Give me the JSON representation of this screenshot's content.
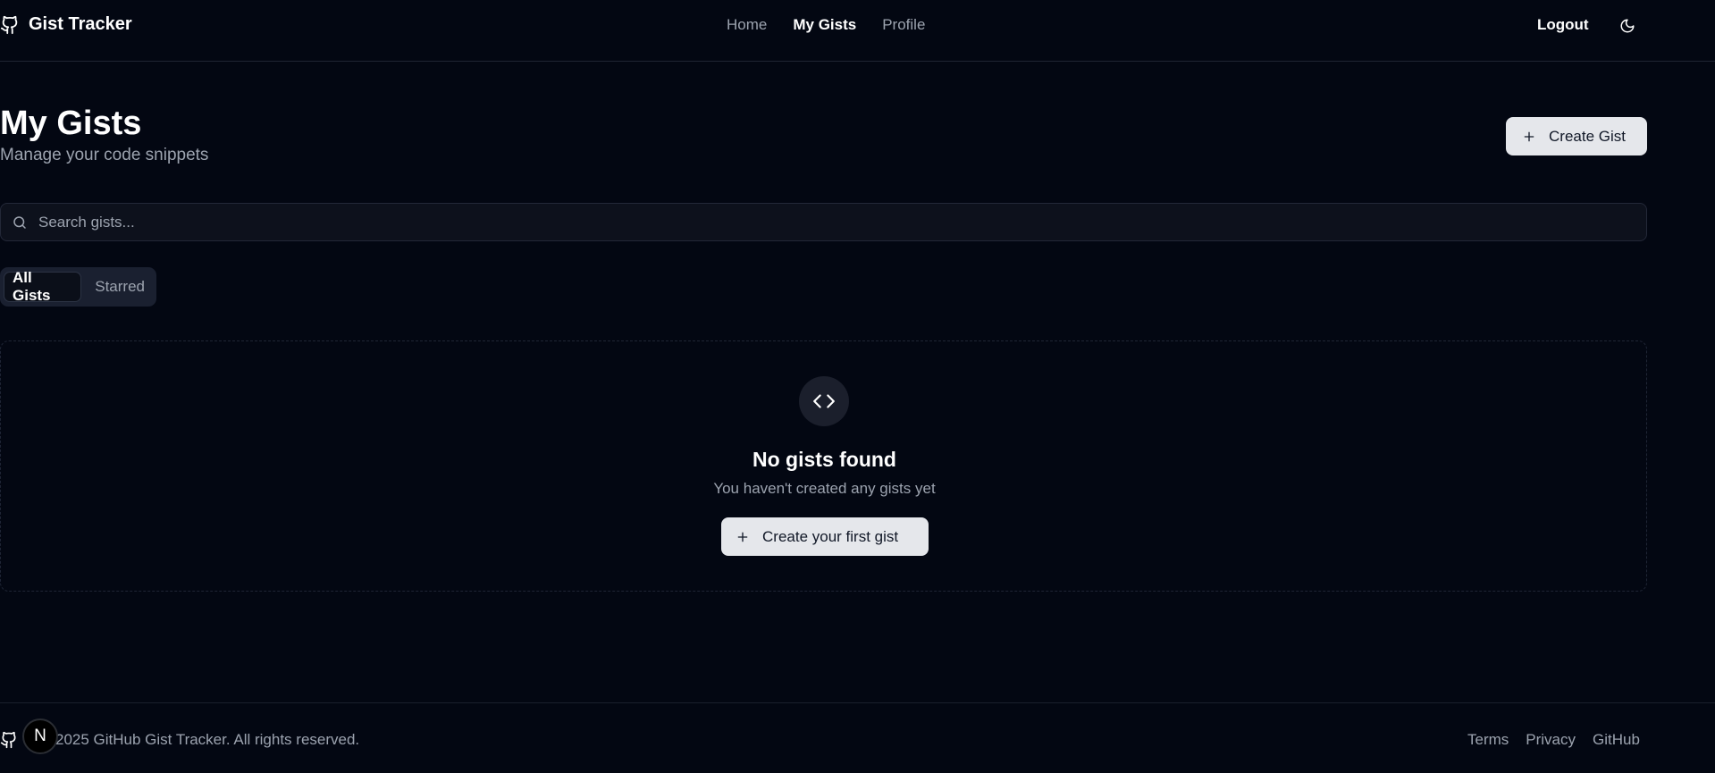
{
  "header": {
    "app_name": "Gist Tracker",
    "nav": [
      "Home",
      "My Gists",
      "Profile"
    ],
    "active_nav": "My Gists",
    "logout_label": "Logout",
    "theme_icon": "moon-icon"
  },
  "page": {
    "title": "My Gists",
    "subtitle": "Manage your code snippets",
    "create_button": "Create Gist"
  },
  "search": {
    "placeholder": "Search gists...",
    "value": ""
  },
  "tabs": {
    "items": [
      "All Gists",
      "Starred"
    ],
    "active": "All Gists"
  },
  "empty_state": {
    "icon": "code-icon",
    "title": "No gists found",
    "description": "You haven't created any gists yet",
    "button": "Create your first gist"
  },
  "footer": {
    "copyright": "2025 GitHub Gist Tracker. All rights reserved.",
    "links": [
      "Terms",
      "Privacy",
      "GitHub"
    ]
  },
  "dev_badge": {
    "letter": "N"
  },
  "colors": {
    "background": "#030712",
    "text_primary": "#ffffff",
    "text_muted": "#9ca3af",
    "button_bg": "#e5e7eb"
  }
}
